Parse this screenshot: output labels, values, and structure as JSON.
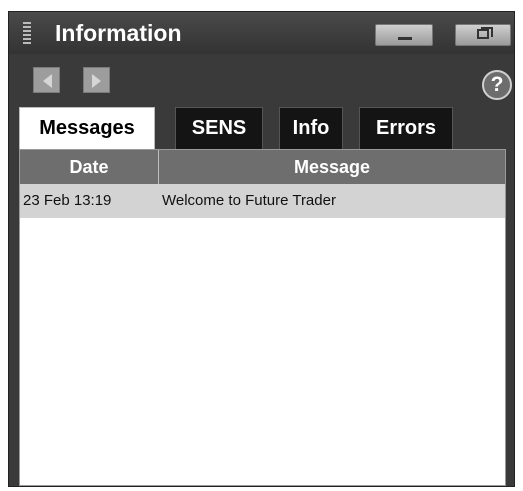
{
  "window": {
    "title": "Information",
    "controls": {
      "minimize": "minimize-icon",
      "restore": "restore-icon"
    }
  },
  "nav": {
    "back_icon": "arrow-left-icon",
    "forward_icon": "arrow-right-icon",
    "help_label": "?"
  },
  "tabs": [
    {
      "label": "Messages",
      "active": true
    },
    {
      "label": "SENS",
      "active": false
    },
    {
      "label": "Info",
      "active": false
    },
    {
      "label": "Errors",
      "active": false
    }
  ],
  "table": {
    "columns": [
      "Date",
      "Message"
    ],
    "rows": [
      {
        "date": "23 Feb 13:19",
        "message": "Welcome to Future Trader"
      }
    ]
  }
}
